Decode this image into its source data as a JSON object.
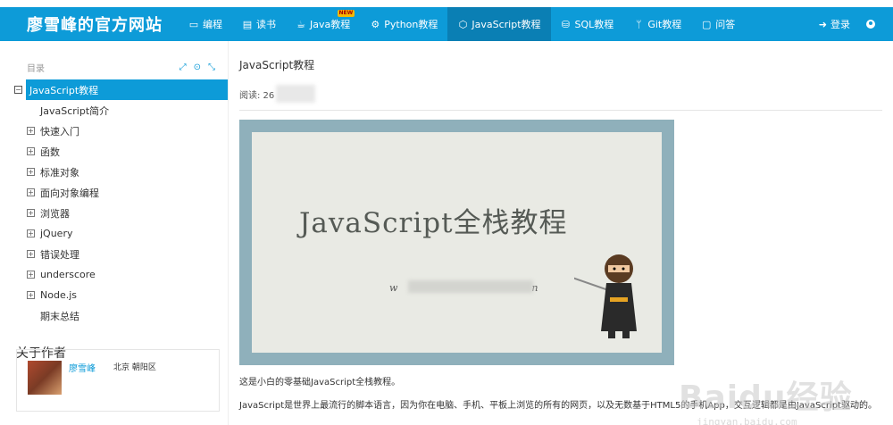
{
  "site": {
    "brand": "廖雪峰的官方网站"
  },
  "nav": {
    "items": [
      {
        "label": "编程",
        "icon": "code-icon"
      },
      {
        "label": "读书",
        "icon": "book-icon"
      },
      {
        "label": "Java教程",
        "icon": "coffee-icon",
        "badge": "NEW"
      },
      {
        "label": "Python教程",
        "icon": "python-icon"
      },
      {
        "label": "JavaScript教程",
        "icon": "js-icon"
      },
      {
        "label": "SQL教程",
        "icon": "database-icon"
      },
      {
        "label": "Git教程",
        "icon": "git-icon"
      },
      {
        "label": "问答",
        "icon": "chat-icon"
      }
    ],
    "login": "登录"
  },
  "toc": {
    "header": "目录",
    "items": [
      {
        "label": "JavaScript教程",
        "state": "active",
        "marker": "⊟"
      },
      {
        "label": "JavaScript简介",
        "state": "sub",
        "marker": ""
      },
      {
        "label": "快速入门",
        "state": "exp",
        "marker": "+"
      },
      {
        "label": "函数",
        "state": "exp",
        "marker": "+"
      },
      {
        "label": "标准对象",
        "state": "exp",
        "marker": "+"
      },
      {
        "label": "面向对象编程",
        "state": "exp",
        "marker": "+"
      },
      {
        "label": "浏览器",
        "state": "exp",
        "marker": "+"
      },
      {
        "label": "jQuery",
        "state": "exp",
        "marker": "+"
      },
      {
        "label": "错误处理",
        "state": "exp",
        "marker": "+"
      },
      {
        "label": "underscore",
        "state": "exp",
        "marker": "+"
      },
      {
        "label": "Node.js",
        "state": "exp",
        "marker": "+"
      },
      {
        "label": "期末总结",
        "state": "sub",
        "marker": ""
      }
    ]
  },
  "about": {
    "title": "关于作者",
    "name": "廖雪峰",
    "location": "北京 朝阳区"
  },
  "article": {
    "title": "JavaScript教程",
    "reads_label": "阅读: 26",
    "banner_title": "JavaScript全栈教程",
    "banner_sub": "w",
    "banner_sub_end": "n",
    "p1": "这是小白的零基础JavaScript全栈教程。",
    "p2": "JavaScript是世界上最流行的脚本语言，因为你在电脑、手机、平板上浏览的所有的网页，以及无数基于HTML5的手机App，交互逻辑都是由JavaScript驱动的。"
  },
  "watermark": {
    "brand": "Baidu经验",
    "url": "jingyan.baidu.com"
  },
  "colors": {
    "accent": "#0d9bd8",
    "accent_dark": "#0a7fb4"
  }
}
